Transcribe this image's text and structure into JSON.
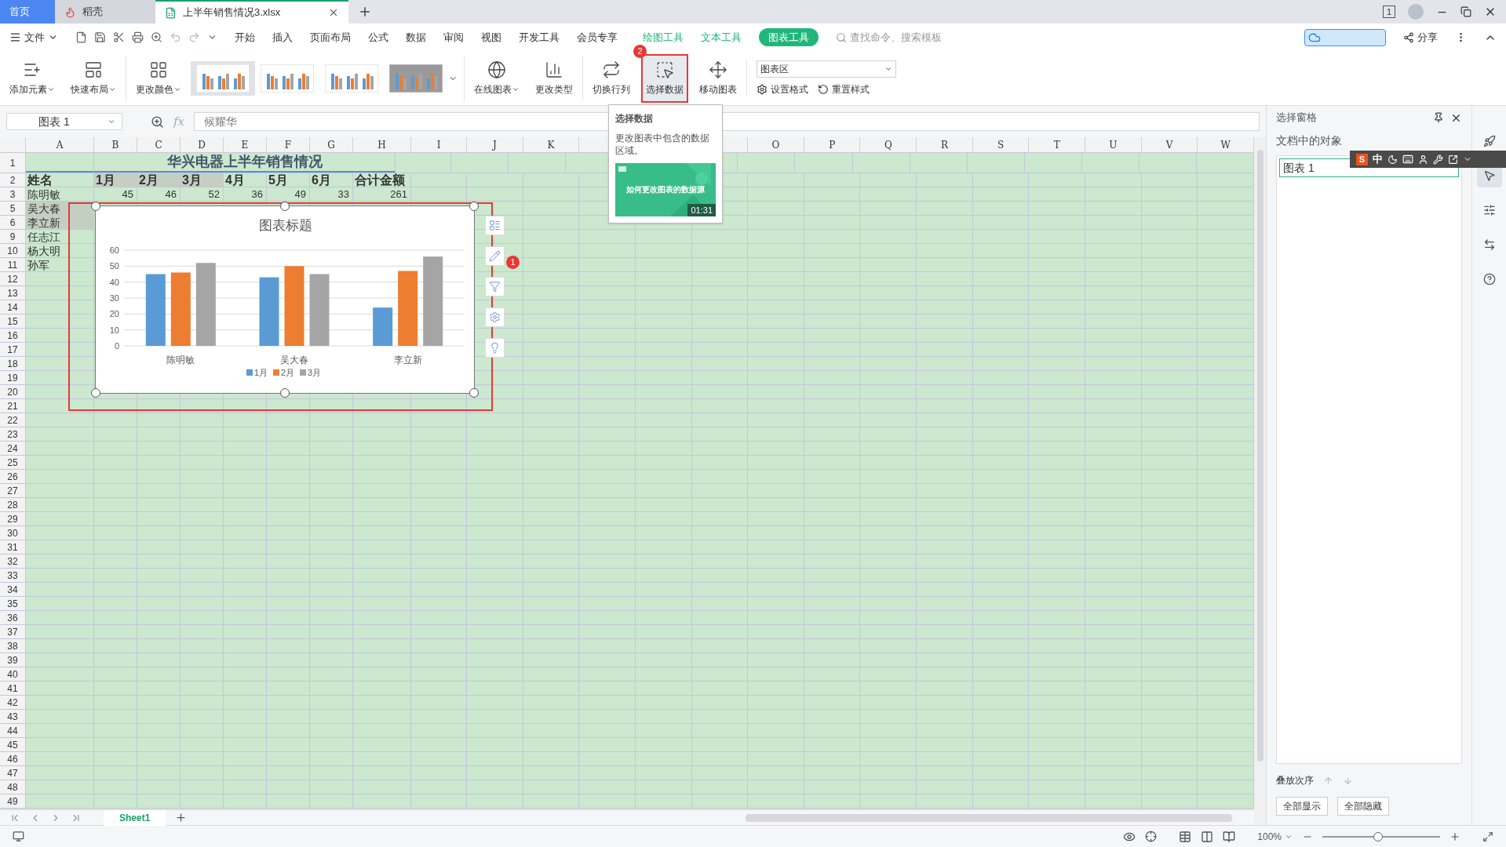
{
  "tabs": [
    {
      "label": "首页",
      "selected": false,
      "kind": "home"
    },
    {
      "label": "稻壳",
      "selected": false,
      "kind": "docer"
    },
    {
      "label": "上半年销售情况3.xlsx",
      "selected": true,
      "kind": "sheet"
    }
  ],
  "window": {
    "count": "1"
  },
  "menu": {
    "file": "文件",
    "items": [
      {
        "label": "开始",
        "selected": false
      },
      {
        "label": "插入",
        "selected": false
      },
      {
        "label": "页面布局",
        "selected": false
      },
      {
        "label": "公式",
        "selected": false
      },
      {
        "label": "数据",
        "selected": false
      },
      {
        "label": "审阅",
        "selected": false
      },
      {
        "label": "视图",
        "selected": false
      },
      {
        "label": "开发工具",
        "selected": false
      },
      {
        "label": "会员专享",
        "selected": false
      }
    ],
    "context_tabs": [
      {
        "label": "绘图工具",
        "selected": false
      },
      {
        "label": "文本工具",
        "selected": false
      },
      {
        "label": "图表工具",
        "selected": true
      }
    ],
    "search": {
      "placeholder": "查找命令、搜索模板"
    },
    "share": "分享"
  },
  "ribbon": {
    "groups": [
      [
        {
          "label": "添加元素",
          "kind": "add",
          "dropdown": true,
          "highlighted": false
        },
        {
          "label": "快速布局",
          "kind": "layout",
          "dropdown": true,
          "highlighted": false
        }
      ],
      [
        {
          "label": "更改颜色",
          "kind": "color",
          "dropdown": true,
          "highlighted": false
        }
      ],
      [
        {
          "label": "在线图表",
          "kind": "online",
          "dropdown": true,
          "highlighted": false
        },
        {
          "label": "更改类型",
          "kind": "type",
          "dropdown": false,
          "highlighted": false
        }
      ],
      [
        {
          "label": "切换行列",
          "kind": "switch",
          "dropdown": false,
          "highlighted": false
        },
        {
          "label": "选择数据",
          "kind": "select",
          "dropdown": false,
          "highlighted": true,
          "badge": "2"
        },
        {
          "label": "移动图表",
          "kind": "move",
          "dropdown": false,
          "highlighted": false
        }
      ]
    ],
    "styles": [
      {
        "selected": true
      },
      {
        "selected": false
      },
      {
        "selected": false
      },
      {
        "selected": false
      }
    ],
    "area_select": {
      "value": "图表区"
    },
    "format": "设置格式",
    "reset": "重置样式"
  },
  "formula_bar": {
    "name_box": "图表 1",
    "fx": "fx",
    "value": "候耀华"
  },
  "sheet": {
    "columns": [
      "A",
      "B",
      "C",
      "D",
      "E",
      "F",
      "G",
      "H",
      "I",
      "J",
      "K",
      "O",
      "P",
      "Q",
      "R",
      "S",
      "T",
      "U",
      "V",
      "W"
    ],
    "rows": [
      {
        "number": "1",
        "title": "华兴电器上半年销售情况"
      },
      {
        "number": "2",
        "kind": "header",
        "cells": [
          {
            "text": "姓名",
            "kind": "text",
            "selected": false
          },
          {
            "text": "1月",
            "kind": "text",
            "selected": true
          },
          {
            "text": "2月",
            "kind": "text",
            "selected": true
          },
          {
            "text": "3月",
            "kind": "text",
            "selected": true
          },
          {
            "text": "4月",
            "kind": "text",
            "selected": false
          },
          {
            "text": "5月",
            "kind": "text",
            "selected": false
          },
          {
            "text": "6月",
            "kind": "text",
            "selected": false
          },
          {
            "text": "合计金额",
            "kind": "text",
            "selected": false
          }
        ]
      },
      {
        "number": "3",
        "kind": "data",
        "cells": [
          {
            "text": "陈明敏",
            "kind": "text",
            "selected": false
          },
          {
            "text": "45",
            "kind": "number",
            "selected": false
          },
          {
            "text": "46",
            "kind": "number",
            "selected": false
          },
          {
            "text": "52",
            "kind": "number",
            "selected": false
          },
          {
            "text": "36",
            "kind": "number",
            "selected": false
          },
          {
            "text": "49",
            "kind": "number",
            "selected": false
          },
          {
            "text": "33",
            "kind": "number",
            "selected": false
          },
          {
            "text": "261",
            "kind": "number",
            "selected": false
          }
        ]
      },
      {
        "number": "5",
        "kind": "data",
        "cells": [
          {
            "text": "吴大春",
            "kind": "text",
            "selected": true
          }
        ]
      },
      {
        "number": "6",
        "kind": "data",
        "cells": [
          {
            "text": "李立新",
            "kind": "text",
            "selected": true
          }
        ]
      },
      {
        "number": "9",
        "kind": "data",
        "cells": [
          {
            "text": "任志江",
            "kind": "text",
            "selected": false
          }
        ]
      },
      {
        "number": "10",
        "kind": "data",
        "cells": [
          {
            "text": "杨大明",
            "kind": "text",
            "selected": false
          }
        ]
      },
      {
        "number": "11",
        "kind": "data",
        "cells": [
          {
            "text": "孙军",
            "kind": "text",
            "selected": false
          }
        ]
      },
      {
        "number": "12"
      },
      {
        "number": "13"
      },
      {
        "number": "14"
      },
      {
        "number": "15"
      },
      {
        "number": "16"
      },
      {
        "number": "17"
      },
      {
        "number": "18"
      },
      {
        "number": "19"
      },
      {
        "number": "20"
      },
      {
        "number": "21"
      },
      {
        "number": "22"
      },
      {
        "number": "23"
      },
      {
        "number": "24"
      },
      {
        "number": "25"
      },
      {
        "number": "26"
      },
      {
        "number": "27"
      },
      {
        "number": "28"
      },
      {
        "number": "29"
      },
      {
        "number": "30"
      },
      {
        "number": "31"
      },
      {
        "number": "32"
      },
      {
        "number": "33"
      },
      {
        "number": "34"
      },
      {
        "number": "35"
      },
      {
        "number": "36"
      },
      {
        "number": "37"
      },
      {
        "number": "38"
      },
      {
        "number": "39"
      },
      {
        "number": "40"
      },
      {
        "number": "41"
      },
      {
        "number": "42"
      },
      {
        "number": "43"
      },
      {
        "number": "44"
      },
      {
        "number": "45"
      },
      {
        "number": "46"
      },
      {
        "number": "47"
      },
      {
        "number": "48"
      },
      {
        "number": "49"
      }
    ]
  },
  "chart": {
    "highlighted": true,
    "chart_data": {
      "type": "bar",
      "title": "图表标题",
      "categories": [
        "陈明敏",
        "吴大春",
        "李立新"
      ],
      "series": [
        {
          "name": "1月",
          "color": "#5b9bd5",
          "values": [
            45,
            43,
            24
          ]
        },
        {
          "name": "2月",
          "color": "#ed7d31",
          "values": [
            46,
            50,
            47
          ]
        },
        {
          "name": "3月",
          "color": "#a5a5a5",
          "values": [
            52,
            45,
            56
          ]
        }
      ],
      "ylim": [
        0,
        60
      ],
      "yticks": [
        0,
        10,
        20,
        30,
        40,
        50,
        60
      ],
      "grid": true,
      "legend": "bottom"
    },
    "side_tools": [
      {
        "kind": "elements"
      },
      {
        "kind": "style",
        "badge": "1"
      },
      {
        "kind": "filter"
      },
      {
        "kind": "settings"
      },
      {
        "kind": "idea"
      }
    ]
  },
  "tooltip": {
    "title": "选择数据",
    "text": "更改图表中包含的数据区域。",
    "video": {
      "title": "如何更改图表的数据源",
      "duration": "01:31"
    }
  },
  "pane": {
    "title": "选择窗格",
    "heading": "文档中的对象",
    "objects": [
      {
        "label": "图表 1",
        "selected": true
      }
    ],
    "order_label": "叠放次序",
    "buttons": [
      "全部显示",
      "全部隐藏"
    ]
  },
  "strip": [
    {
      "kind": "rocket",
      "selected": false
    },
    {
      "kind": "pointer",
      "selected": true
    },
    {
      "kind": "sliders",
      "selected": false
    },
    {
      "kind": "swap",
      "selected": false
    },
    {
      "kind": "help",
      "selected": false
    }
  ],
  "ime": {
    "logo": "S",
    "mode": "中"
  },
  "sheet_tabs": [
    {
      "label": "Sheet1",
      "selected": true
    }
  ],
  "status": {
    "zoom": "100%",
    "level": 0.47
  }
}
